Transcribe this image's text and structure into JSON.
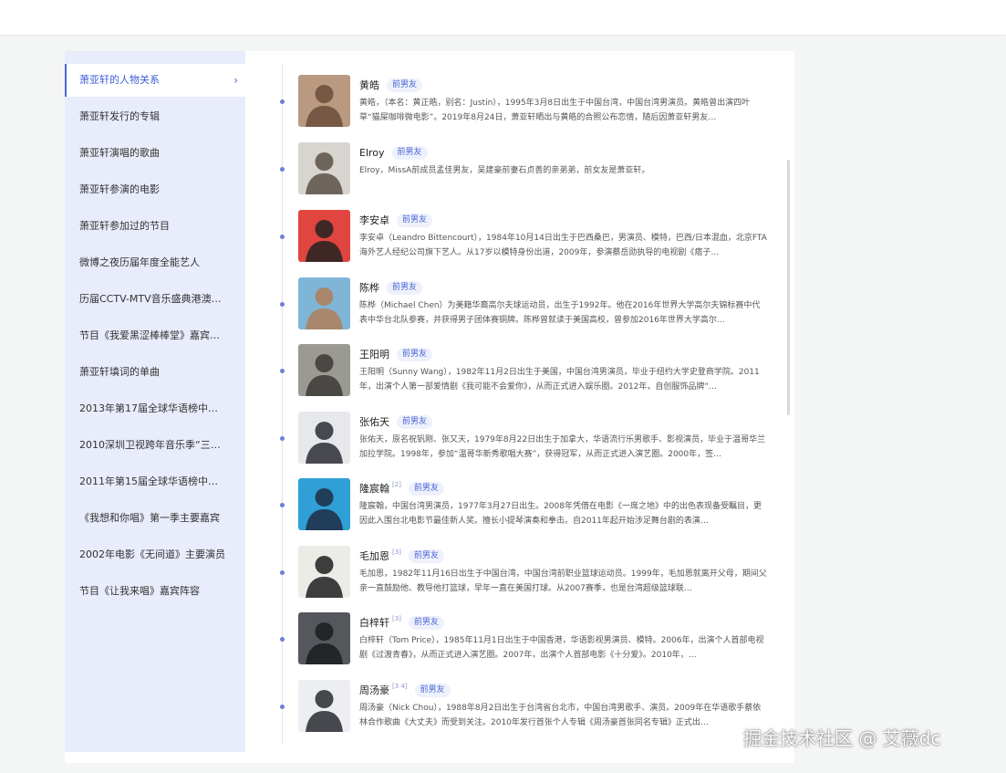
{
  "sidebar": {
    "items": [
      {
        "label": "萧亚轩的人物关系",
        "active": true
      },
      {
        "label": "萧亚轩发行的专辑"
      },
      {
        "label": "萧亚轩演唱的歌曲"
      },
      {
        "label": "萧亚轩参演的电影"
      },
      {
        "label": "萧亚轩参加过的节目"
      },
      {
        "label": "微博之夜历届年度全能艺人"
      },
      {
        "label": "历届CCTV-MTV音乐盛典港澳台…"
      },
      {
        "label": "节目《我爱黑涩棒棒堂》嘉宾…"
      },
      {
        "label": "萧亚轩填词的单曲"
      },
      {
        "label": "2013年第17届全球华语榜中榜…"
      },
      {
        "label": "2010深圳卫视跨年音乐季“三…"
      },
      {
        "label": "2011年第15届全球华语榜中榜…"
      },
      {
        "label": "《我想和你唱》第一季主要嘉宾"
      },
      {
        "label": "2002年电影《无间道》主要演员"
      },
      {
        "label": "节目《让我来唱》嘉宾阵容"
      }
    ],
    "active_arrow": "›"
  },
  "relations": [
    {
      "name": "黄皓",
      "sup": "",
      "tag": "前男友",
      "desc": "黄皓，（本名：黄正皓，别名：Justin），1995年3月8日出生于中国台湾，中国台湾男演员。黄皓曾出演四叶草“猫屎咖啡微电影”。2019年8月24日，萧亚轩晒出与黄皓的合照公布恋情，随后因萧亚轩男友…",
      "photo_bg": "#b99a80",
      "photo_fg": "#6b4c3a"
    },
    {
      "name": "Elroy",
      "sup": "",
      "tag": "前男友",
      "desc": "Elroy，MissA前成员孟佳男友，吴建豪前妻石贞善的亲弟弟，前女友是萧亚轩。",
      "photo_bg": "#d8d4cf",
      "photo_fg": "#5a5048"
    },
    {
      "name": "李安卓",
      "sup": "",
      "tag": "前男友",
      "desc": "李安卓（Leandro Bittencourt），1984年10月14日出生于巴西桑巴，男演员、模特，巴西/日本混血，北京FTA海外艺人经纪公司旗下艺人。从17岁以模特身份出道，2009年，参演蔡岳勋执导的电视剧《痞子…",
      "photo_bg": "#e0453f",
      "photo_fg": "#222222"
    },
    {
      "name": "陈桦",
      "sup": "",
      "tag": "前男友",
      "desc": "陈桦（Michael Chen）为美籍华裔高尔夫球运动员，出生于1992年。他在2016年世界大学高尔夫锦标赛中代表中华台北队参赛，并获得男子团体赛铜牌。陈桦曾就读于美国高校，曾参加2016年世界大学高尔…",
      "photo_bg": "#7fb6d8",
      "photo_fg": "#b07f5a"
    },
    {
      "name": "王阳明",
      "sup": "",
      "tag": "前男友",
      "desc": "王阳明（Sunny Wang），1982年11月2日出生于美国，中国台湾男演员，毕业于纽约大学史登商学院。2011年，出演个人第一部爱情剧《我可能不会爱你》，从而正式进入娱乐圈。2012年，自创服饰品牌“…",
      "photo_bg": "#9a9a92",
      "photo_fg": "#3c3a36"
    },
    {
      "name": "张佑天",
      "sup": "",
      "tag": "前男友",
      "desc": "张佑天，原名祝钒刚、张又天，1979年8月22日出生于加拿大，华语流行乐男歌手、影视演员，毕业于温哥华兰加拉学院。1998年，参加“温哥华新秀歌唱大赛”，获得冠军，从而正式进入演艺圈。2000年，签…",
      "photo_bg": "#e6e8ec",
      "photo_fg": "#2b2b35"
    },
    {
      "name": "隆宸翰",
      "sup": "[2]",
      "tag": "前男友",
      "desc": "隆宸翰，中国台湾男演员，1977年3月27日出生。2008年凭借在电影《一席之地》中的出色表现备受瞩目，更因此入围台北电影节最佳新人奖。擅长小提琴演奏和拳击。自2011年起开始涉足舞台剧的表演…",
      "photo_bg": "#2f9fd6",
      "photo_fg": "#1e2c44"
    },
    {
      "name": "毛加恩",
      "sup": "[3]",
      "tag": "前男友",
      "desc": "毛加恩，1982年11月16日出生于中国台湾，中国台湾前职业篮球运动员。1999年，毛加恩就离开父母，期间父亲一直鼓励他、教导他打篮球，早年一直在美国打球。从2007赛季，也是台湾超级篮球联…",
      "photo_bg": "#ecebe6",
      "photo_fg": "#1f1f1f"
    },
    {
      "name": "白梓轩",
      "sup": "[3]",
      "tag": "前男友",
      "desc": "白梓轩（Tom Price），1985年11月1日出生于中国香港，华语影视男演员、模特。2006年，出演个人首部电视剧《过渡青春》，从而正式进入演艺圈。2007年，出演个人首部电影《十分爱》。2010年，…",
      "photo_bg": "#55575c",
      "photo_fg": "#1c1c1e"
    },
    {
      "name": "周汤豪",
      "sup": "[3 4]",
      "tag": "前男友",
      "desc": "周汤豪（Nick Chou），1988年8月2日出生于台湾省台北市，中国台湾男歌手、演员。2009年在华语歌手蔡依林合作歌曲《大丈夫》而受到关注。2010年发行首张个人专辑《周汤豪首张同名专辑》正式出…",
      "photo_bg": "#eceef2",
      "photo_fg": "#2a2a30"
    }
  ],
  "watermark": "掘金技术社区 @ 艾薇dc",
  "colors": {
    "accent": "#4a67d6",
    "sidebar_bg": "#e8ecfb",
    "page_bg": "#f4f5f5"
  }
}
